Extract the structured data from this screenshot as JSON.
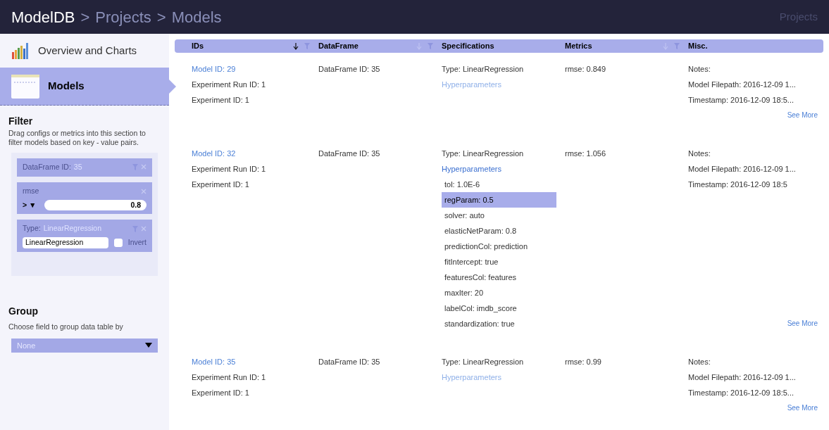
{
  "header": {
    "breadcrumb": [
      "ModelDB",
      "Projects",
      "Models"
    ],
    "separator": ">",
    "right_link": "Projects"
  },
  "sidebar": {
    "items": [
      {
        "label": "Overview and Charts",
        "kind": "charts",
        "selected": false
      },
      {
        "label": "Models",
        "kind": "table",
        "selected": true
      }
    ],
    "filter": {
      "title": "Filter",
      "description": "Drag configs or metrics into this section to filter models based on key - value pairs.",
      "chips": [
        {
          "kind": "plain",
          "key": "DataFrame ID:",
          "value": "35"
        },
        {
          "kind": "numeric",
          "key": "rmse",
          "operator": "> ▼",
          "input": "0.8"
        },
        {
          "kind": "text",
          "key": "Type:",
          "value": "LinearRegression",
          "input": "LinearRegression",
          "invert_label": "Invert",
          "invert": false
        }
      ]
    },
    "group": {
      "title": "Group",
      "description": "Choose field to group data table by",
      "select": "None"
    }
  },
  "table": {
    "columns": [
      {
        "label": "IDs",
        "sorted": true
      },
      {
        "label": "DataFrame",
        "sorted": false
      },
      {
        "label": "Specifications"
      },
      {
        "label": "Metrics",
        "sorted": false
      },
      {
        "label": "Misc."
      }
    ],
    "rows": [
      {
        "model_id": "Model ID: 29",
        "run_id": "Experiment Run ID: 1",
        "experiment_id": "Experiment ID: 1",
        "dataframe": "DataFrame ID: 35",
        "type": "Type: LinearRegression",
        "hyperparameters": "Hyperparameters",
        "expanded": false,
        "metric": "rmse: 0.849",
        "notes": "Notes:",
        "filepath": "Model Filepath: 2016-12-09 1...",
        "timestamp": "Timestamp: 2016-12-09 18:5...",
        "see_more": "See More"
      },
      {
        "model_id": "Model ID: 32",
        "run_id": "Experiment Run ID: 1",
        "experiment_id": "Experiment ID: 1",
        "dataframe": "DataFrame ID: 35",
        "type": "Type: LinearRegression",
        "hyperparameters": "Hyperparameters",
        "expanded": true,
        "params": [
          {
            "text": "tol: 1.0E-6",
            "selected": false
          },
          {
            "text": "regParam: 0.5",
            "selected": true
          },
          {
            "text": "solver: auto",
            "selected": false
          },
          {
            "text": "elasticNetParam: 0.8",
            "selected": false
          },
          {
            "text": "predictionCol: prediction",
            "selected": false
          },
          {
            "text": "fitIntercept: true",
            "selected": false
          },
          {
            "text": "featuresCol: features",
            "selected": false
          },
          {
            "text": "maxIter: 20",
            "selected": false
          },
          {
            "text": "labelCol: imdb_score",
            "selected": false
          },
          {
            "text": "standardization: true",
            "selected": false
          }
        ],
        "metric": "rmse: 1.056",
        "notes": "Notes:",
        "filepath": "Model Filepath: 2016-12-09 1...",
        "timestamp": "Timestamp: 2016-12-09 18:5",
        "see_more": "See More"
      },
      {
        "model_id": "Model ID: 35",
        "run_id": "Experiment Run ID: 1",
        "experiment_id": "Experiment ID: 1",
        "dataframe": "DataFrame ID: 35",
        "type": "Type: LinearRegression",
        "hyperparameters": "Hyperparameters",
        "expanded": false,
        "metric": "rmse: 0.99",
        "notes": "Notes:",
        "filepath": "Model Filepath: 2016-12-09 1...",
        "timestamp": "Timestamp: 2016-12-09 18:5...",
        "see_more": "See More"
      }
    ]
  }
}
